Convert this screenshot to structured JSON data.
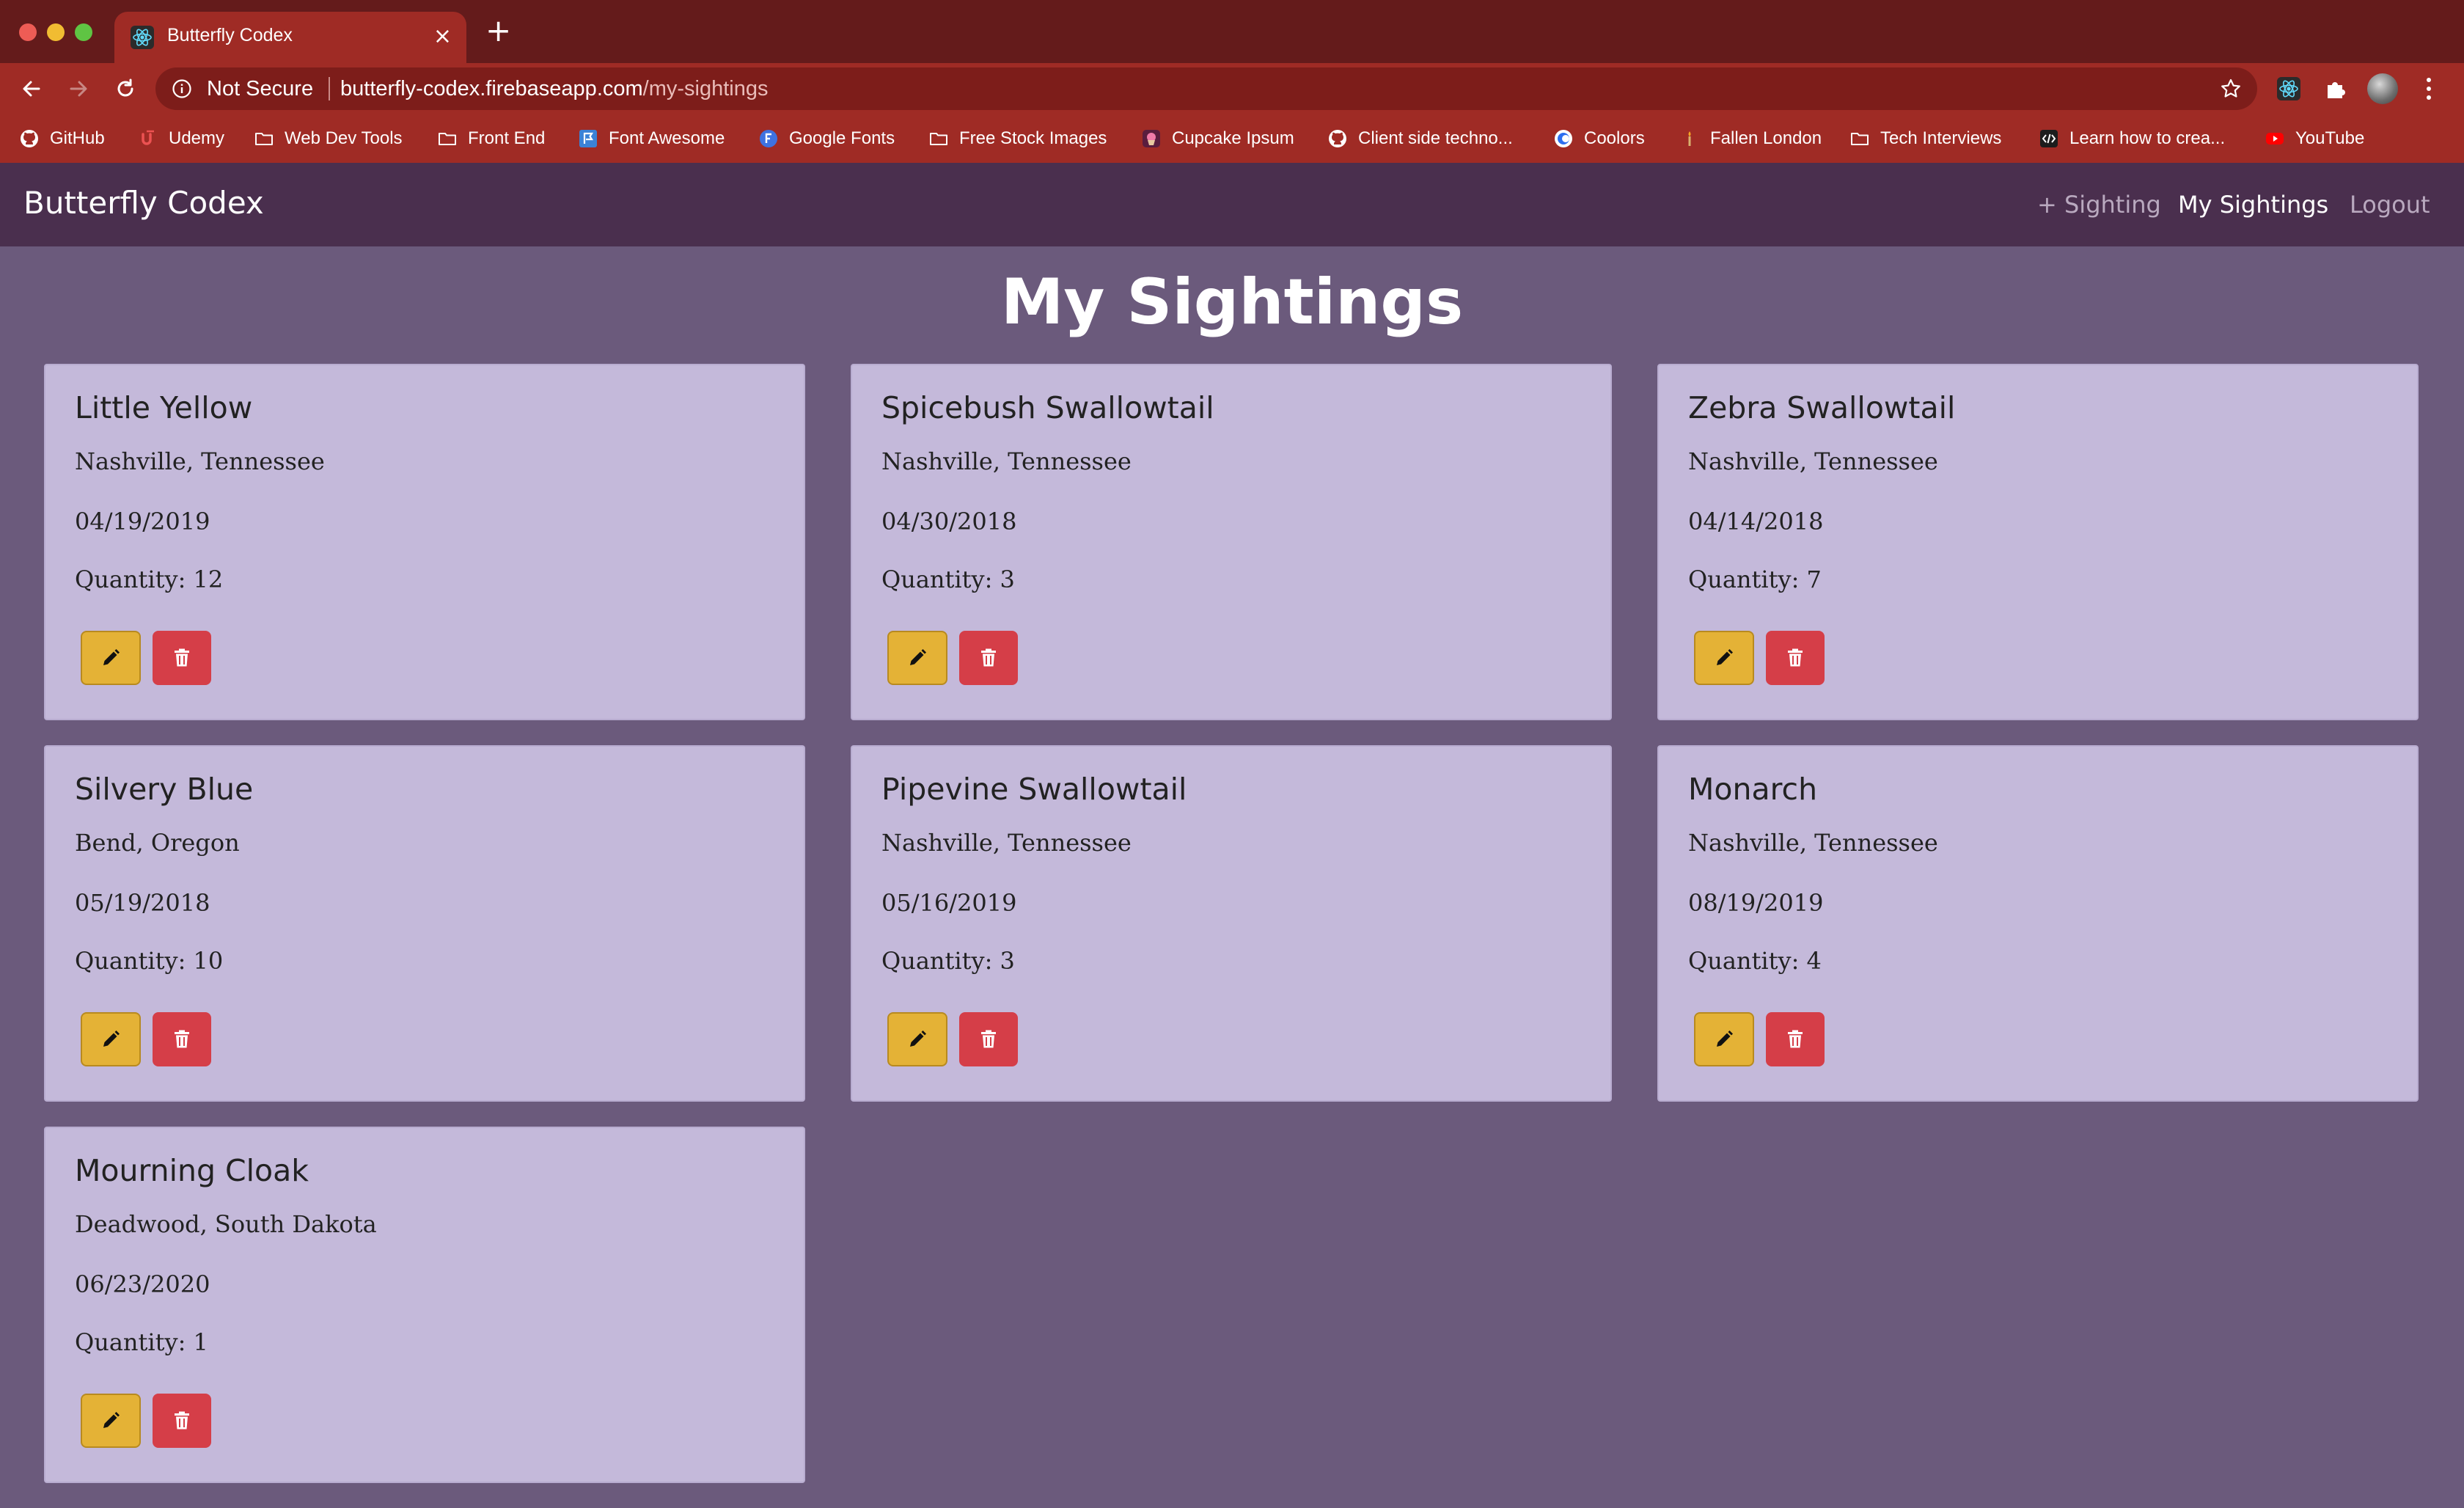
{
  "browser": {
    "tab_title": "Butterfly Codex",
    "tab_close": "×",
    "new_tab": "+",
    "security_label": "Not Secure",
    "url_host": "butterfly-codex.firebaseapp.com",
    "url_path": "/my-sightings",
    "bookmarks": [
      {
        "label": "GitHub",
        "icon": "github-icon"
      },
      {
        "label": "Udemy",
        "icon": "udemy-icon"
      },
      {
        "label": "Web Dev Tools",
        "icon": "folder-icon"
      },
      {
        "label": "Front End",
        "icon": "folder-icon"
      },
      {
        "label": "Font Awesome",
        "icon": "flag-icon"
      },
      {
        "label": "Google Fonts",
        "icon": "google-fonts-icon"
      },
      {
        "label": "Free Stock Images",
        "icon": "folder-icon"
      },
      {
        "label": "Cupcake Ipsum",
        "icon": "cupcake-icon"
      },
      {
        "label": "Client side techno...",
        "icon": "github-icon"
      },
      {
        "label": "Coolors",
        "icon": "coolors-icon"
      },
      {
        "label": "Fallen London",
        "icon": "candle-icon"
      },
      {
        "label": "Tech Interviews",
        "icon": "folder-icon"
      },
      {
        "label": "Learn how to crea...",
        "icon": "code-icon"
      },
      {
        "label": "YouTube",
        "icon": "youtube-icon"
      }
    ]
  },
  "app": {
    "brand": "Butterfly Codex",
    "nav": {
      "add_sighting": "+ Sighting",
      "my_sightings": "My Sightings",
      "logout": "Logout"
    },
    "page_title": "My Sightings",
    "sightings": [
      {
        "name": "Little Yellow",
        "location": "Nashville, Tennessee",
        "date": "04/19/2019",
        "quantity": "Quantity: 12"
      },
      {
        "name": "Spicebush Swallowtail",
        "location": "Nashville, Tennessee",
        "date": "04/30/2018",
        "quantity": "Quantity: 3"
      },
      {
        "name": "Zebra Swallowtail",
        "location": "Nashville, Tennessee",
        "date": "04/14/2018",
        "quantity": "Quantity: 7"
      },
      {
        "name": "Silvery Blue",
        "location": "Bend, Oregon",
        "date": "05/19/2018",
        "quantity": "Quantity: 10"
      },
      {
        "name": "Pipevine Swallowtail",
        "location": "Nashville, Tennessee",
        "date": "05/16/2019",
        "quantity": "Quantity: 3"
      },
      {
        "name": "Monarch",
        "location": "Nashville, Tennessee",
        "date": "08/19/2019",
        "quantity": "Quantity: 4"
      },
      {
        "name": "Mourning Cloak",
        "location": "Deadwood, South Dakota",
        "date": "06/23/2020",
        "quantity": "Quantity: 1"
      }
    ]
  },
  "colors": {
    "chrome_dark": "#641b1b",
    "chrome": "#9f2b25",
    "app_nav": "#4a2f4e",
    "page_bg": "#6b5a7c",
    "card_bg": "#c4b9da",
    "edit_button": "#e4b236",
    "delete_button": "#d53e48"
  }
}
